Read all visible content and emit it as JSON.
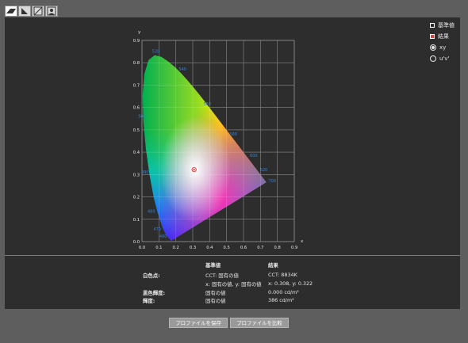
{
  "toolbar": {
    "buttons": [
      {
        "icon": "gamut-icon",
        "active": true
      },
      {
        "icon": "tone-curve-icon",
        "active": false
      },
      {
        "icon": "grayscale-icon",
        "active": false
      },
      {
        "icon": "portrait-icon",
        "active": false
      }
    ]
  },
  "legend": {
    "reference_label": "基準値",
    "result_label": "結果",
    "mode_xy": "xy",
    "mode_uv": "u'v'",
    "selected_mode": "xy",
    "reference_color": "#ffffff",
    "result_color": "#e04040"
  },
  "chart_data": {
    "type": "scatter",
    "title": "",
    "xlabel": "x",
    "ylabel": "y",
    "xlim": [
      0.0,
      0.9
    ],
    "ylim": [
      0.0,
      0.9
    ],
    "xticks": [
      "0.0",
      "0.1",
      "0.2",
      "0.3",
      "0.4",
      "0.5",
      "0.6",
      "0.7",
      "0.8",
      "0.9"
    ],
    "yticks": [
      "0.0",
      "0.1",
      "0.2",
      "0.3",
      "0.4",
      "0.5",
      "0.6",
      "0.7",
      "0.8",
      "0.9"
    ],
    "grid": true,
    "wavelength_labels": [
      "520",
      "500",
      "490",
      "480",
      "470",
      "460",
      "540",
      "560",
      "580",
      "600",
      "620",
      "700"
    ],
    "series": [
      {
        "values": [
          {
            "x": 0.308,
            "y": 0.322
          }
        ]
      }
    ]
  },
  "info": {
    "header_reference": "基準値",
    "header_result": "結果",
    "rows": [
      {
        "label": "白色点:",
        "reference": "CCT: 固有の値",
        "result": "CCT: 8834K"
      },
      {
        "label": "",
        "reference": "x: 固有の値, y: 固有の値",
        "result": "x: 0.308, y: 0.322"
      },
      {
        "label": "黒色輝度:",
        "reference": "固有の値",
        "result": "0.000 cd/m²"
      },
      {
        "label": "輝度:",
        "reference": "固有の値",
        "result": "386 cd/m²"
      }
    ]
  },
  "buttons": {
    "save": "プロファイルを保存",
    "compare": "プロファイルを比較"
  }
}
